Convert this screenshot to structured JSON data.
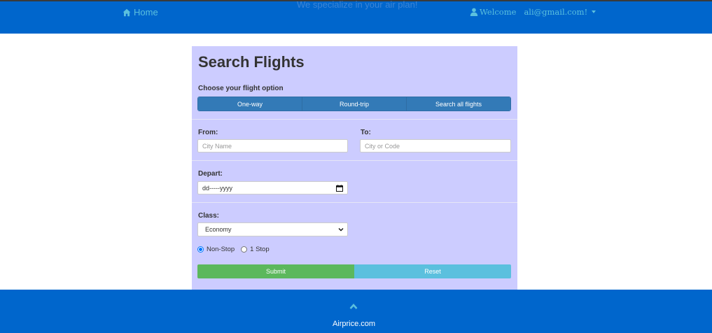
{
  "header": {
    "tagline": "We specialize in your air plan!",
    "home_label": "Home",
    "welcome_label": "Welcome",
    "user_email": "ali@gmail.com!"
  },
  "form": {
    "title": "Search Flights",
    "option_label": "Choose your flight option",
    "trip_options": [
      "One-way",
      "Round-trip",
      "Search all flights"
    ],
    "from_label": "From:",
    "from_placeholder": "City Name",
    "to_label": "To:",
    "to_placeholder": "City or Code",
    "depart_label": "Depart:",
    "depart_value": "dd-----yyyy",
    "class_label": "Class:",
    "class_selected": "Economy",
    "stops": [
      {
        "label": "Non-Stop",
        "checked": true
      },
      {
        "label": "1 Stop",
        "checked": false
      }
    ],
    "submit_label": "Submit",
    "reset_label": "Reset"
  },
  "footer": {
    "brand": "Airprice.com"
  },
  "colors": {
    "header_bg": "#0066cc",
    "panel_bg": "#ccccff",
    "link": "#5bc0de",
    "primary_btn": "#337ab7",
    "success_btn": "#5cb85c",
    "info_btn": "#5bc0de"
  },
  "icons": {
    "home": "home-icon",
    "user": "user-icon",
    "caret": "caret-down-icon",
    "calendar": "calendar-icon",
    "chevron": "chevron-down-icon",
    "scroll_top": "chevron-up-icon"
  }
}
